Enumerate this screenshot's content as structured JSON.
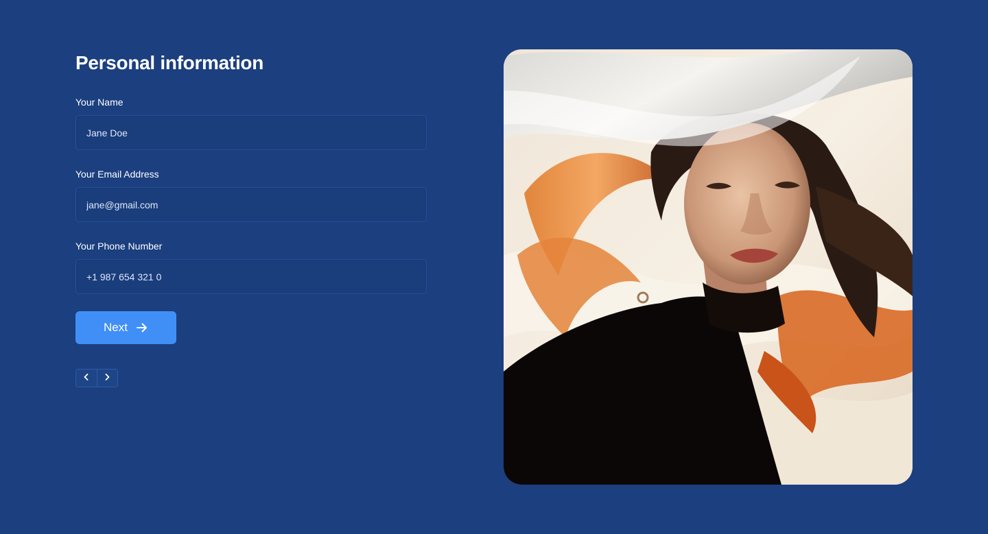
{
  "page": {
    "title": "Personal information"
  },
  "fields": {
    "name": {
      "label": "Your Name",
      "value": "Jane Doe"
    },
    "email": {
      "label": "Your Email Address",
      "value": "jane@gmail.com"
    },
    "phone": {
      "label": "Your Phone Number",
      "value": "+1 987 654 321 0"
    }
  },
  "actions": {
    "next_label": "Next",
    "next_icon": "arrow-right-icon",
    "prev_icon": "chevron-left-icon",
    "forward_icon": "chevron-right-icon"
  },
  "colors": {
    "background": "#1b3f7f",
    "accent": "#3f8ff7"
  }
}
